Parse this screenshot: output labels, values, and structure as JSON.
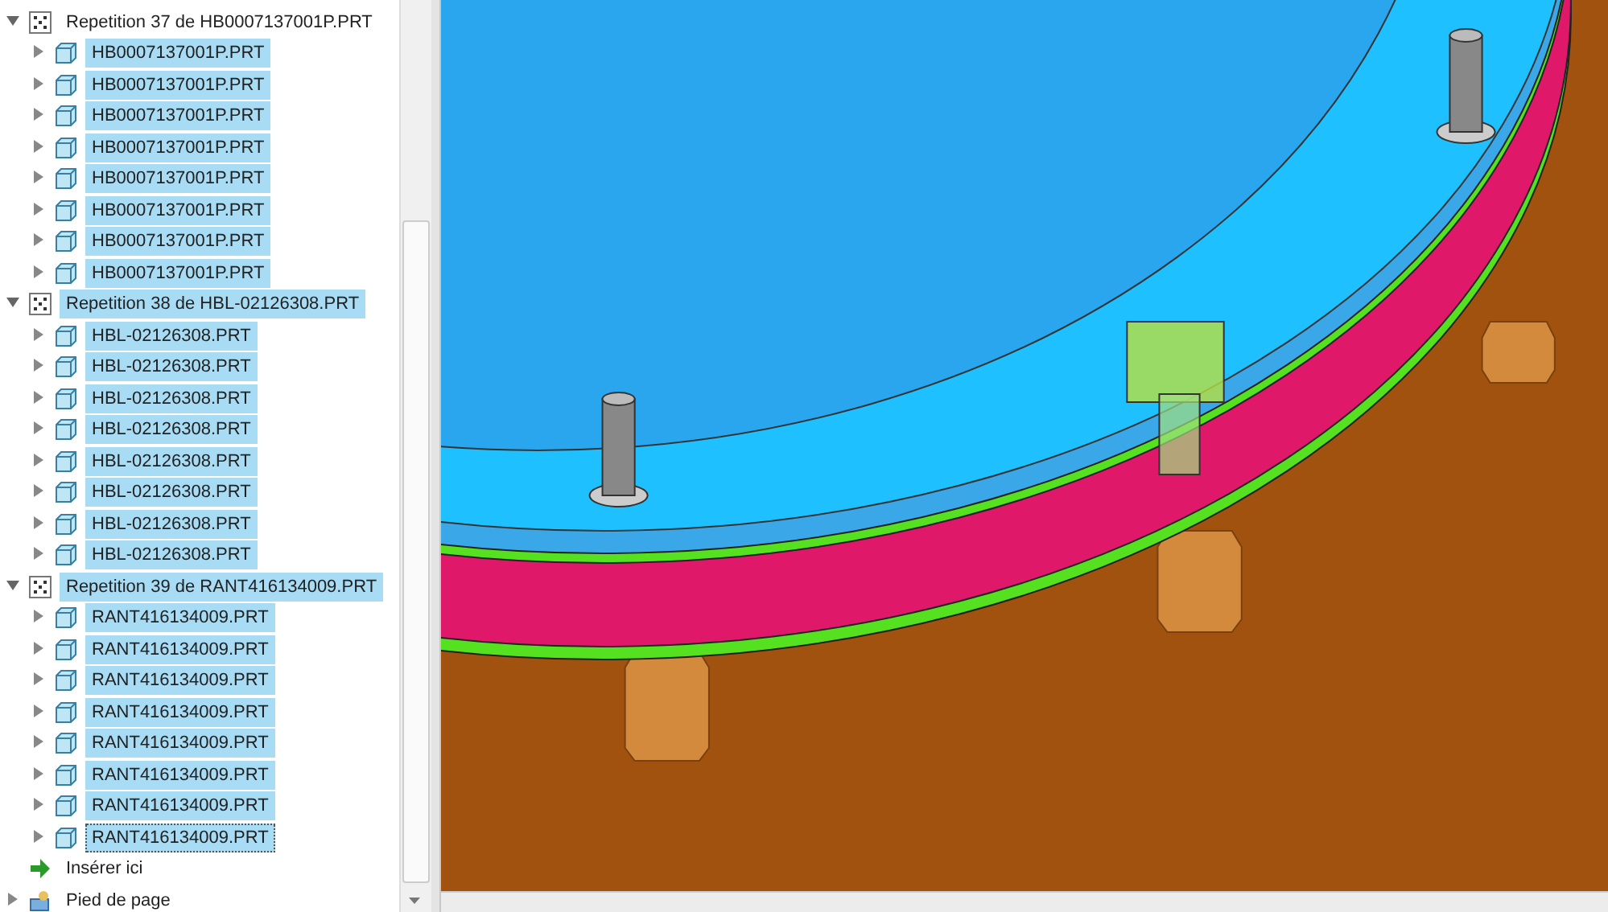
{
  "model_tree": {
    "items": [
      {
        "kind": "group",
        "label": "Repetition 37 de HB0007137001P.PRT",
        "expanded": true,
        "selected": false,
        "children": [
          {
            "kind": "part",
            "label": "HB0007137001P.PRT",
            "selected": true,
            "focused": false
          },
          {
            "kind": "part",
            "label": "HB0007137001P.PRT",
            "selected": true,
            "focused": false
          },
          {
            "kind": "part",
            "label": "HB0007137001P.PRT",
            "selected": true,
            "focused": false
          },
          {
            "kind": "part",
            "label": "HB0007137001P.PRT",
            "selected": true,
            "focused": false
          },
          {
            "kind": "part",
            "label": "HB0007137001P.PRT",
            "selected": true,
            "focused": false
          },
          {
            "kind": "part",
            "label": "HB0007137001P.PRT",
            "selected": true,
            "focused": false
          },
          {
            "kind": "part",
            "label": "HB0007137001P.PRT",
            "selected": true,
            "focused": false
          },
          {
            "kind": "part",
            "label": "HB0007137001P.PRT",
            "selected": true,
            "focused": false
          }
        ]
      },
      {
        "kind": "group",
        "label": "Repetition 38 de HBL-02126308.PRT",
        "expanded": true,
        "selected": true,
        "children": [
          {
            "kind": "part",
            "label": "HBL-02126308.PRT",
            "selected": true,
            "focused": false
          },
          {
            "kind": "part",
            "label": "HBL-02126308.PRT",
            "selected": true,
            "focused": false
          },
          {
            "kind": "part",
            "label": "HBL-02126308.PRT",
            "selected": true,
            "focused": false
          },
          {
            "kind": "part",
            "label": "HBL-02126308.PRT",
            "selected": true,
            "focused": false
          },
          {
            "kind": "part",
            "label": "HBL-02126308.PRT",
            "selected": true,
            "focused": false
          },
          {
            "kind": "part",
            "label": "HBL-02126308.PRT",
            "selected": true,
            "focused": false
          },
          {
            "kind": "part",
            "label": "HBL-02126308.PRT",
            "selected": true,
            "focused": false
          },
          {
            "kind": "part",
            "label": "HBL-02126308.PRT",
            "selected": true,
            "focused": false
          }
        ]
      },
      {
        "kind": "group",
        "label": "Repetition 39 de RANT416134009.PRT",
        "expanded": true,
        "selected": true,
        "children": [
          {
            "kind": "part",
            "label": "RANT416134009.PRT",
            "selected": true,
            "focused": false
          },
          {
            "kind": "part",
            "label": "RANT416134009.PRT",
            "selected": true,
            "focused": false
          },
          {
            "kind": "part",
            "label": "RANT416134009.PRT",
            "selected": true,
            "focused": false
          },
          {
            "kind": "part",
            "label": "RANT416134009.PRT",
            "selected": true,
            "focused": false
          },
          {
            "kind": "part",
            "label": "RANT416134009.PRT",
            "selected": true,
            "focused": false
          },
          {
            "kind": "part",
            "label": "RANT416134009.PRT",
            "selected": true,
            "focused": false
          },
          {
            "kind": "part",
            "label": "RANT416134009.PRT",
            "selected": true,
            "focused": false
          },
          {
            "kind": "part",
            "label": "RANT416134009.PRT",
            "selected": true,
            "focused": true
          }
        ]
      },
      {
        "kind": "insert",
        "label": "Insérer ici"
      },
      {
        "kind": "footer",
        "label": "Pied de page",
        "expanded": false
      }
    ]
  }
}
